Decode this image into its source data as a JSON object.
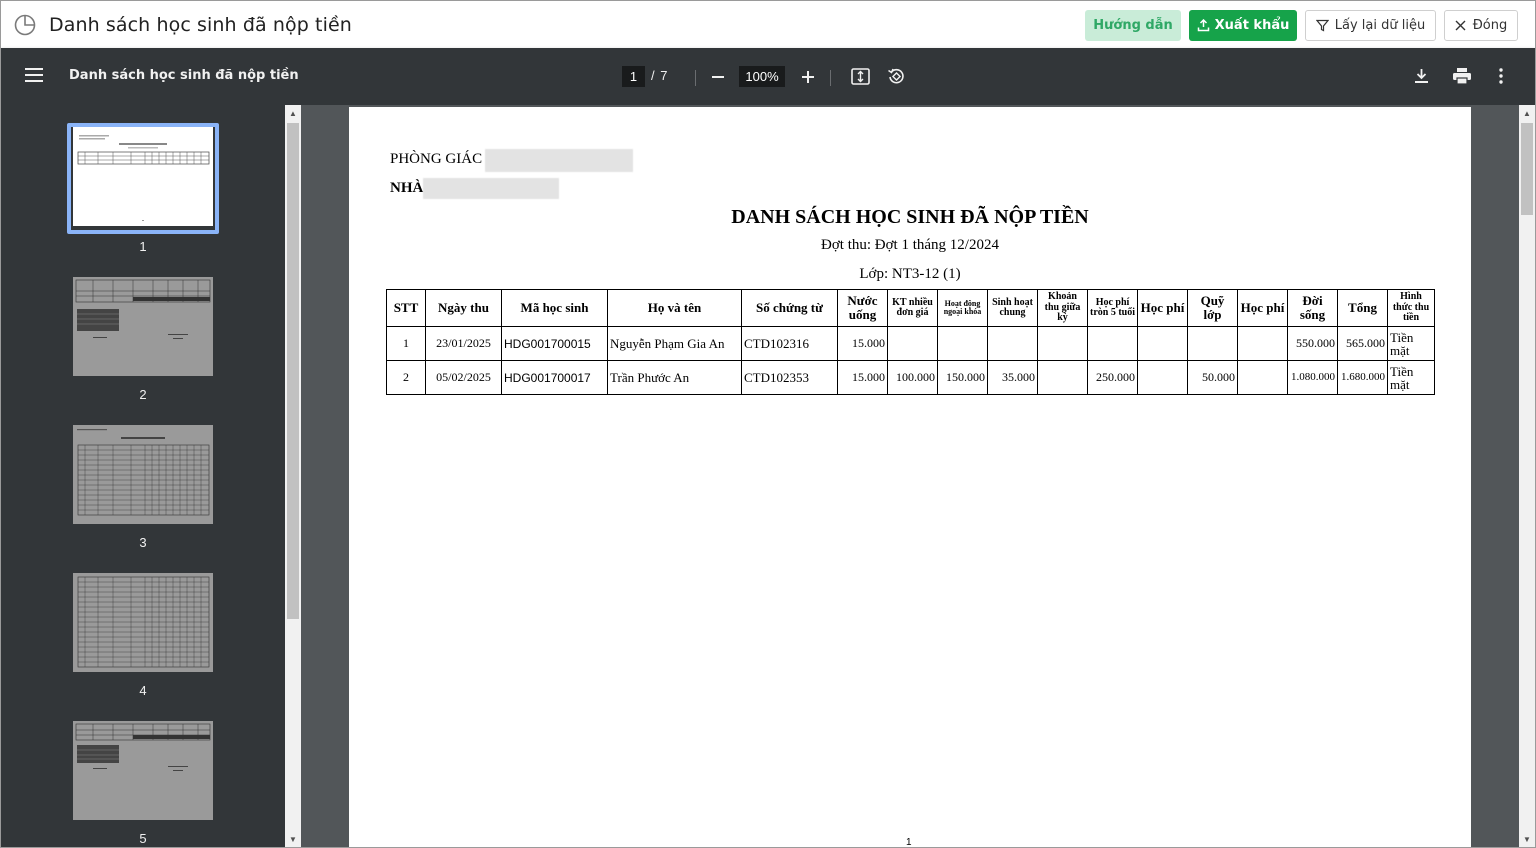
{
  "window": {
    "title": "Danh sách học sinh đã nộp tiền",
    "buttons": {
      "guide": "Hướng dẫn",
      "export": "Xuất khẩu",
      "reload": "Lấy lại dữ liệu",
      "close": "Đóng"
    }
  },
  "viewer": {
    "doc_name": "Danh sách học sinh đã nộp tiền",
    "current_page": "1",
    "total_pages": "/ 7",
    "zoom": "100%"
  },
  "thumbnails": [
    {
      "label": "1"
    },
    {
      "label": "2"
    },
    {
      "label": "3"
    },
    {
      "label": "4"
    },
    {
      "label": "5"
    }
  ],
  "document": {
    "dept_line": "PHÒNG GIÁC",
    "school_line": "NHÀ",
    "title": "DANH SÁCH HỌC SINH ĐÃ NỘP TIỀN",
    "period": "Đợt thu: Đợt 1 tháng 12/2024",
    "class": "Lớp: NT3-12 (1)",
    "page_footer": "1",
    "columns": [
      "STT",
      "Ngày thu",
      "Mã học sinh",
      "Họ và tên",
      "Số chứng từ",
      "Nước uống",
      "KT nhiều đơn giá",
      "Hoạt động ngoại khóa",
      "Sinh hoạt chung",
      "Khoản thu giữa kỳ",
      "Học phí tròn 5 tuổi",
      "Học phí",
      "Quỹ lớp",
      "Học phí",
      "Đời sống",
      "Tổng",
      "Hình thức thu tiền"
    ],
    "rows": [
      [
        "1",
        "23/01/2025",
        "HDG001700015",
        "Nguyễn Phạm Gia An",
        "CTD102316",
        "15.000",
        "",
        "",
        "",
        "",
        "",
        "",
        "",
        "",
        "550.000",
        "565.000",
        "Tiền mặt"
      ],
      [
        "2",
        "05/02/2025",
        "HDG001700017",
        "Trần Phước An",
        "CTD102353",
        "15.000",
        "100.000",
        "150.000",
        "35.000",
        "",
        "250.000",
        "",
        "50.000",
        "",
        "1.080.000",
        "1.680.000",
        "Tiền mặt"
      ]
    ]
  }
}
